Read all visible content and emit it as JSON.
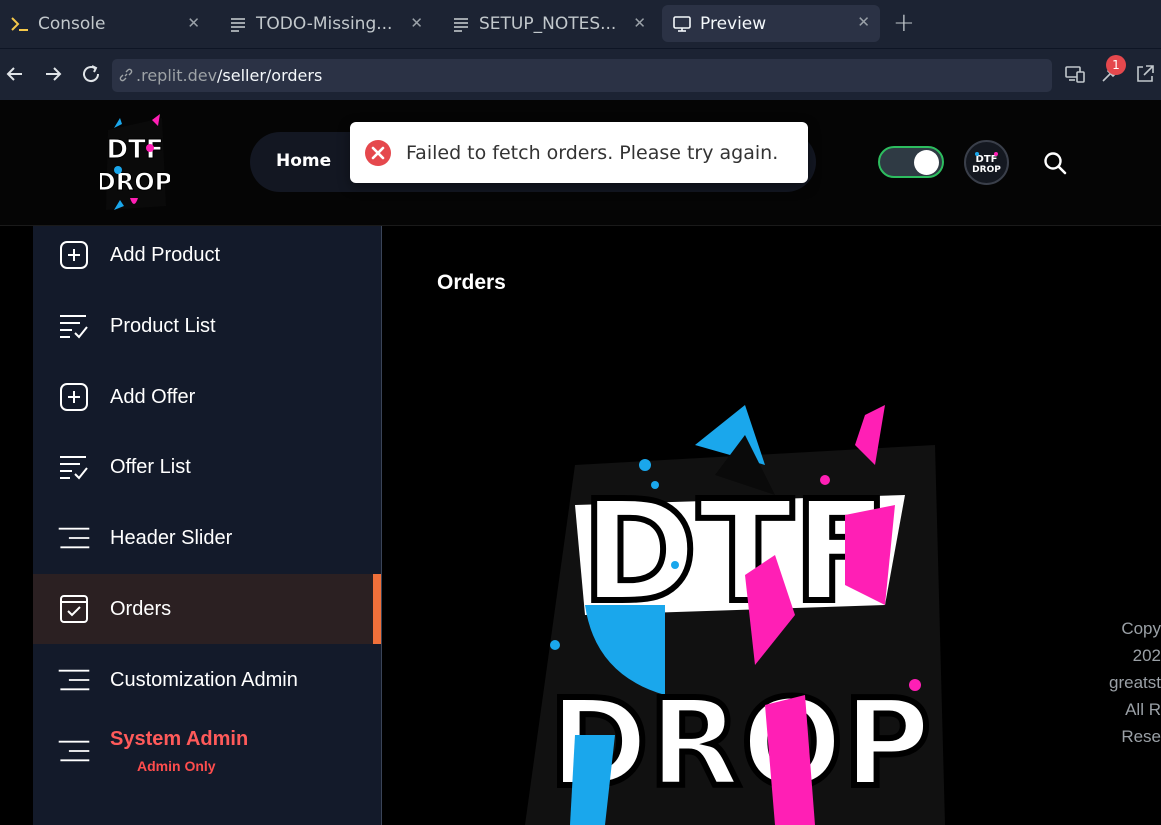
{
  "tabs": [
    {
      "label": "Console",
      "icon": "terminal-icon",
      "active": false
    },
    {
      "label": "TODO-Missing...",
      "icon": "document-icon",
      "active": false
    },
    {
      "label": "SETUP_NOTES...",
      "icon": "document-icon",
      "active": false
    },
    {
      "label": "Preview",
      "icon": "monitor-icon",
      "active": true
    }
  ],
  "address": {
    "host": ".replit.dev",
    "path": "/seller/orders",
    "notification_count": "1"
  },
  "header": {
    "nav_home": "Home",
    "logo_alt": "DTF DROP",
    "toast": "Failed to fetch orders. Please try again."
  },
  "sidebar": {
    "items": [
      {
        "label": "Add Product",
        "icon": "plus-square-icon"
      },
      {
        "label": "Product List",
        "icon": "checklist-icon"
      },
      {
        "label": "Add Offer",
        "icon": "plus-square-icon"
      },
      {
        "label": "Offer List",
        "icon": "checklist-icon"
      },
      {
        "label": "Header Slider",
        "icon": "lines-icon"
      },
      {
        "label": "Orders",
        "icon": "check-square-icon",
        "active": true
      },
      {
        "label": "Customization Admin",
        "icon": "lines-icon"
      },
      {
        "label": "System Admin",
        "sub": "Admin Only",
        "icon": "lines-icon"
      }
    ]
  },
  "main": {
    "title": "Orders",
    "copyright_lines": [
      "Copy",
      "202",
      "greatst",
      "All R",
      "Rese"
    ]
  },
  "colors": {
    "accent": "#f0703a",
    "admin_red": "#ff5a5a",
    "toast_error": "#e5484d",
    "toggle_border": "#2dbd5f"
  }
}
